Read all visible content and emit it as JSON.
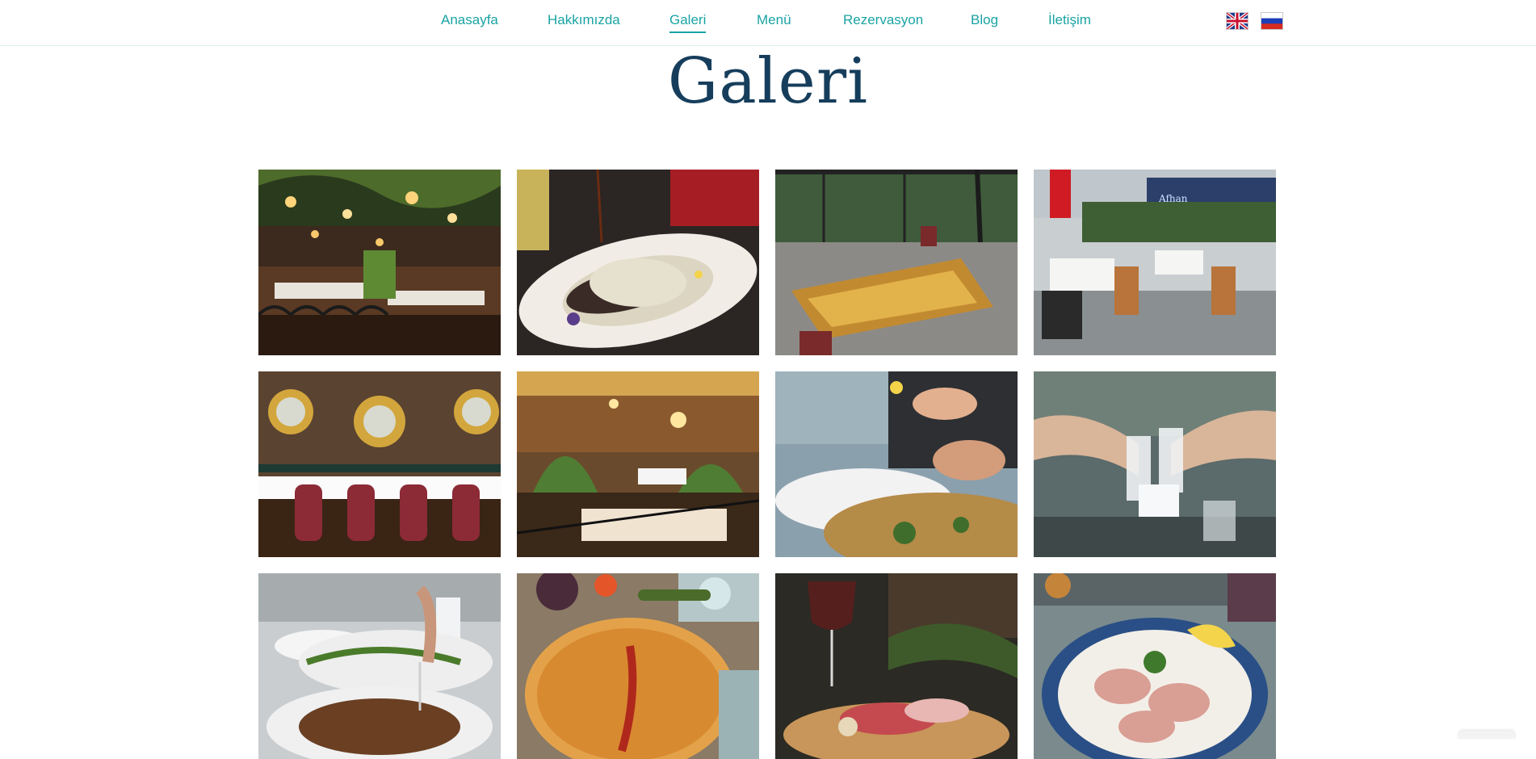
{
  "nav": {
    "items": [
      {
        "label": "Anasayfa"
      },
      {
        "label": "Hakkımızda"
      },
      {
        "label": "Galeri",
        "active": true
      },
      {
        "label": "Menü"
      },
      {
        "label": "Rezervasyon"
      },
      {
        "label": "Blog"
      },
      {
        "label": "İletişim"
      }
    ],
    "accent_color": "#1aa3a3",
    "languages": [
      "english-flag-icon",
      "russian-flag-icon"
    ]
  },
  "page": {
    "title": "Galeri",
    "title_color": "#163e5c"
  },
  "gallery": {
    "columns": 4,
    "rows_visible": 3,
    "images": [
      {
        "name": "gallery-image-restaurant-interior-lights"
      },
      {
        "name": "gallery-image-stuffed-eggplant-dish"
      },
      {
        "name": "gallery-image-terrace-wooden-table"
      },
      {
        "name": "gallery-image-outdoor-terrace-flag",
        "sign_text": "Afhan"
      },
      {
        "name": "gallery-image-sun-mirrors-wall"
      },
      {
        "name": "gallery-image-dining-hall-plants"
      },
      {
        "name": "gallery-image-lemon-squeeze-lahmacun"
      },
      {
        "name": "gallery-image-raki-toast"
      },
      {
        "name": "gallery-image-kebab-table"
      },
      {
        "name": "gallery-image-pide-with-pepper"
      },
      {
        "name": "gallery-image-wine-and-platter"
      },
      {
        "name": "gallery-image-cold-cuts-plate"
      }
    ]
  }
}
